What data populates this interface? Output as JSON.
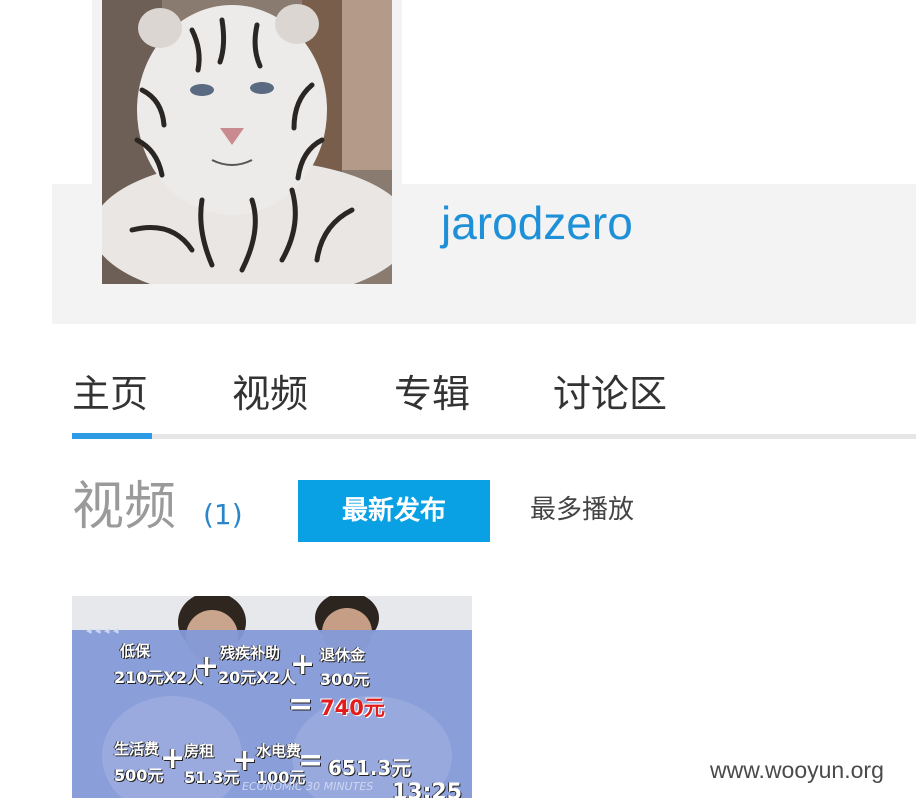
{
  "profile": {
    "username": "jarodzero",
    "avatar_alt": "white tiger avatar"
  },
  "tabs": [
    {
      "label": "主页",
      "active": true
    },
    {
      "label": "视频",
      "active": false
    },
    {
      "label": "专辑",
      "active": false
    },
    {
      "label": "讨论区",
      "active": false
    }
  ],
  "videos_section": {
    "title": "视频",
    "count": "(1)",
    "sort_newest": "最新发布",
    "sort_most_played": "最多播放"
  },
  "video": {
    "duration": "13:25",
    "overlay": {
      "arrows": "◂ ◂ ◂ ◂",
      "label_dibao": "低保",
      "value_dibao": "210元X2人",
      "label_canji": "残疾补助",
      "value_canji": "20元X2人",
      "label_tuixiu": "退休金",
      "value_tuixiu": "300元",
      "total_income": "740元",
      "label_shenghuo": "生活费",
      "value_shenghuo": "500元",
      "label_fangzu": "房租",
      "value_fangzu": "51.3元",
      "label_shuidian": "水电费",
      "value_shuidian": "100元",
      "total_expense": "651.3元",
      "program_tag": "ECONOMIC 30 MINUTES",
      "plus": "+",
      "equals": "="
    }
  },
  "watermark": "www.wooyun.org",
  "colors": {
    "accent_blue": "#0aa1e4",
    "link_blue": "#1e90d8",
    "banner_gray": "#f3f3f3"
  }
}
